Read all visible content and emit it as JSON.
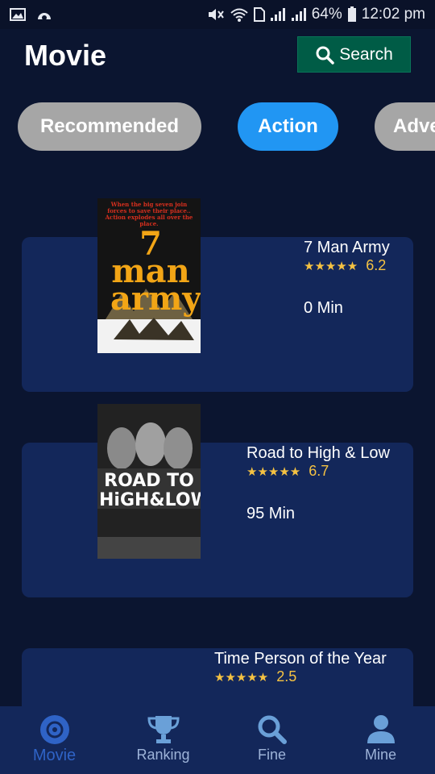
{
  "status_bar": {
    "battery": "64%",
    "time": "12:02 pm"
  },
  "header": {
    "title": "Movie",
    "search_label": "Search"
  },
  "tabs": [
    {
      "label": "Recommended",
      "active": false
    },
    {
      "label": "Action",
      "active": true
    },
    {
      "label": "Adve",
      "active": false
    }
  ],
  "movies": [
    {
      "title": "7 Man Army",
      "stars": "★★★★★",
      "rating": "6.2",
      "duration": "0 Min"
    },
    {
      "title": "Road to High & Low",
      "stars": "★★★★★",
      "rating": "6.7",
      "duration": "95 Min"
    },
    {
      "title": "Time Person of the Year",
      "stars": "★★★★★",
      "rating": "2.5",
      "duration": ""
    }
  ],
  "posters": {
    "poster1_tagline": "When the big seven join forces to save their place.. Action explodes all over the place.",
    "poster1_title": "7 man army",
    "poster2_title": "ROAD TO HiGH&LOW"
  },
  "bottom_nav": [
    {
      "label": "Movie",
      "icon": "disc-icon",
      "active": true
    },
    {
      "label": "Ranking",
      "icon": "trophy-icon",
      "active": false
    },
    {
      "label": "Fine",
      "icon": "search-icon",
      "active": false
    },
    {
      "label": "Mine",
      "icon": "person-icon",
      "active": false
    }
  ],
  "colors": {
    "background": "#0b1530",
    "card": "#13275a",
    "accent_blue": "#2196f3",
    "search_green": "#005c46",
    "star_gold": "#f5c242"
  }
}
